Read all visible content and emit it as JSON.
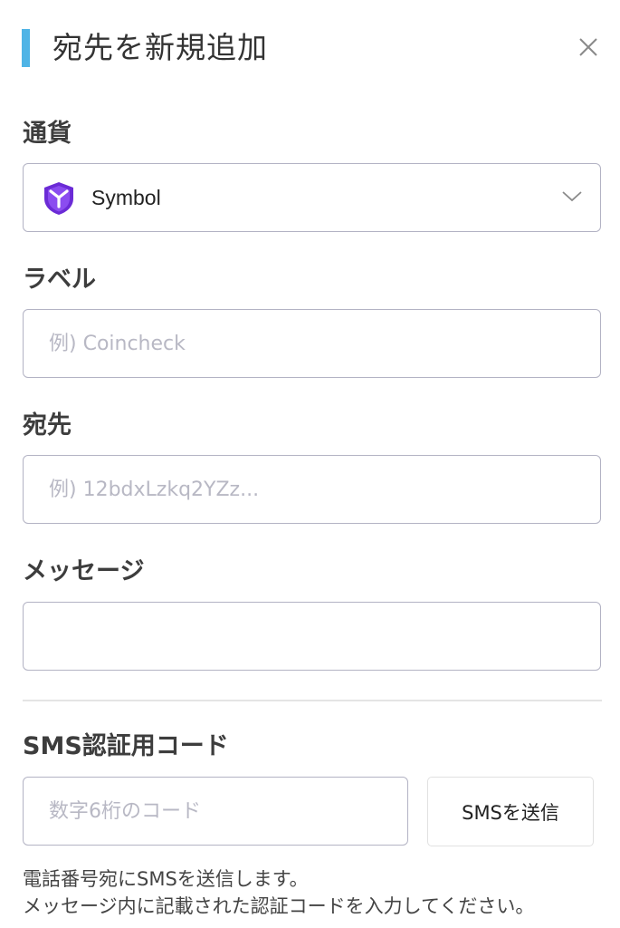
{
  "header": {
    "title": "宛先を新規追加",
    "accent_color": "#4fb4e6",
    "close_icon": "close-icon"
  },
  "currency": {
    "label": "通貨",
    "selected": "Symbol",
    "icon": "symbol-coin-icon",
    "icon_color": "#6b2bd6",
    "dropdown_icon": "chevron-down-icon"
  },
  "label_field": {
    "label": "ラベル",
    "value": "",
    "placeholder": "例) Coincheck"
  },
  "address_field": {
    "label": "宛先",
    "value": "",
    "placeholder": "例) 12bdxLzkq2YZz..."
  },
  "message_field": {
    "label": "メッセージ",
    "value": "",
    "placeholder": ""
  },
  "sms": {
    "label": "SMS認証用コード",
    "value": "",
    "placeholder": "数字6桁のコード",
    "send_button": "SMSを送信",
    "help_lines": [
      "電話番号宛にSMSを送信します。",
      "メッセージ内に記載された認証コードを入力してください。"
    ]
  }
}
